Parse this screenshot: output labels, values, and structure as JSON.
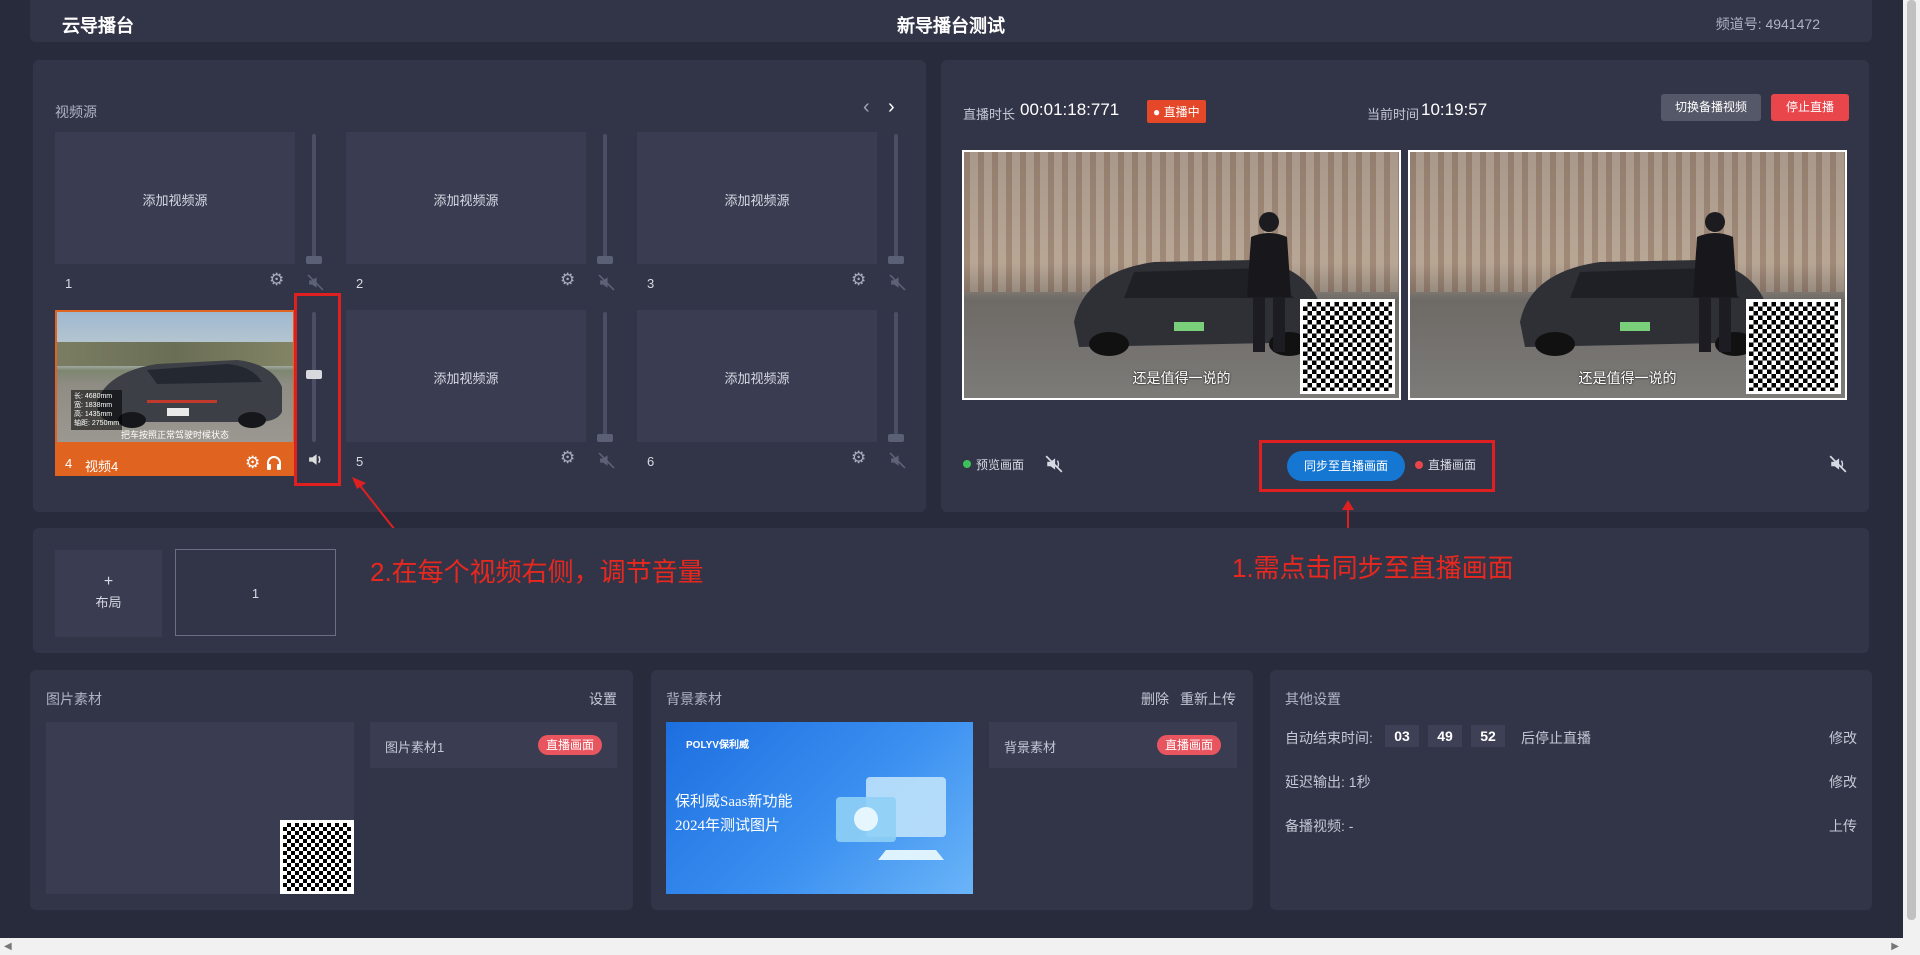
{
  "header": {
    "logo": "云导播台",
    "title": "新导播台测试",
    "channel": "频道号: 4941472"
  },
  "sources": {
    "title": "视频源",
    "add_label": "添加视频源",
    "slots": [
      {
        "number": "1"
      },
      {
        "number": "2"
      },
      {
        "number": "3"
      },
      {
        "number": "4",
        "name": "视频4",
        "active": true
      },
      {
        "number": "5"
      },
      {
        "number": "6"
      }
    ],
    "thumb_overlay": [
      "长: 4680mm",
      "宽: 1838mm",
      "高: 1435mm",
      "轴距: 2750mm"
    ],
    "thumb_caption": "把车按照正常驾驶时候状态",
    "volume_level": 0.55
  },
  "annotations": {
    "volume_note": "2.在每个视频右侧，调节音量",
    "sync_note": "1.需点击同步至直播画面"
  },
  "live": {
    "duration_label": "直播时长",
    "duration": "00:01:18:771",
    "status_badge": "直播中",
    "time_label": "当前时间",
    "time": "10:19:57",
    "switch_button": "切换备播视频",
    "stop_button": "停止直播",
    "subtitle": "还是值得一说的",
    "preview_label": "预览画面",
    "sync_button": "同步至直播画面",
    "live_label": "直播画面"
  },
  "layout": {
    "add_label": "布局",
    "add_symbol": "+",
    "item": "1"
  },
  "images": {
    "title": "图片素材",
    "settings": "设置",
    "item_name": "图片素材1",
    "item_tag": "直播画面"
  },
  "backgrounds": {
    "title": "背景素材",
    "delete": "删除",
    "reupload": "重新上传",
    "item_name": "背景素材",
    "item_tag": "直播画面",
    "brand": "POLYV保利威",
    "line1": "保利威Saas新功能",
    "line2": "2024年测试图片"
  },
  "other": {
    "title": "其他设置",
    "auto_end_label": "自动结束时间:",
    "hh": "03",
    "mm": "49",
    "ss": "52",
    "auto_end_suffix": "后停止直播",
    "edit1": "修改",
    "delay_label": "延迟输出: 1秒",
    "edit2": "修改",
    "backup_label": "备播视频: -",
    "upload": "上传"
  },
  "colors": {
    "accent_red": "#e9555f",
    "accent_blue": "#1677d2",
    "panel": "#323548",
    "bg": "#282b3b"
  }
}
